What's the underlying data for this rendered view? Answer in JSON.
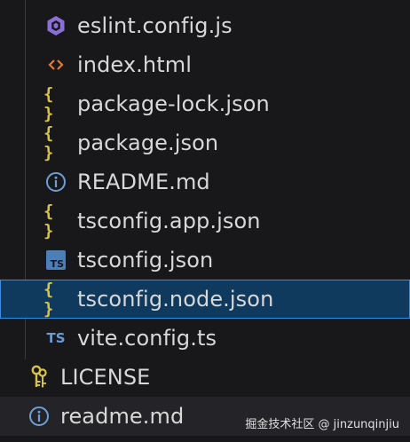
{
  "files": [
    {
      "name": "eslint.config.js",
      "icon": "eslint-icon"
    },
    {
      "name": "index.html",
      "icon": "html-icon"
    },
    {
      "name": "package-lock.json",
      "icon": "json-icon"
    },
    {
      "name": "package.json",
      "icon": "json-icon"
    },
    {
      "name": "README.md",
      "icon": "info-icon"
    },
    {
      "name": "tsconfig.app.json",
      "icon": "json-icon"
    },
    {
      "name": "tsconfig.json",
      "icon": "tsconfig-icon"
    },
    {
      "name": "tsconfig.node.json",
      "icon": "json-icon",
      "selected": true
    },
    {
      "name": "vite.config.ts",
      "icon": "typescript-icon"
    }
  ],
  "root_files": [
    {
      "name": "LICENSE",
      "icon": "license-key-icon"
    },
    {
      "name": "readme.md",
      "icon": "info-icon",
      "hovered": true
    }
  ],
  "icon_glyphs": {
    "json": "{ }",
    "ts": "TS",
    "ts_box": "TS",
    "html": "<>",
    "info": "i"
  },
  "watermark": "掘金技术社区 @ jinzunqinjiu",
  "colors": {
    "background": "#18181b",
    "selection_bg": "#0f3a5e",
    "selection_border": "#3a8ee0",
    "json_icon": "#d8c24a",
    "eslint_icon": "#8b6fd8",
    "html_icon": "#e37933",
    "info_icon": "#6d9fd6",
    "ts_icon": "#4a7fb8",
    "license_icon": "#d4c24a"
  }
}
